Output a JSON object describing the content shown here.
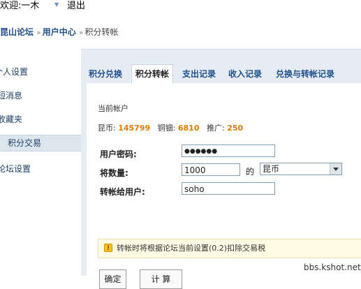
{
  "topbar": {
    "welcome": "欢迎:一木",
    "logout": "退出"
  },
  "breadcrumb": {
    "forum": "昆山论坛",
    "usercenter": "用户中心",
    "current": "积分转帐",
    "separator": "»"
  },
  "sidebar": {
    "items": [
      {
        "label": "个人设置"
      },
      {
        "label": "短消息"
      },
      {
        "label": "收藏夹"
      },
      {
        "label": "积分交易",
        "active": true
      },
      {
        "label": "论坛设置"
      }
    ]
  },
  "tabs": [
    {
      "label": "积分兑换"
    },
    {
      "label": "积分转帐",
      "active": true
    },
    {
      "label": "支出记录"
    },
    {
      "label": "收入记录"
    },
    {
      "label": "兑换与转帐记录"
    }
  ],
  "account": {
    "title": "当前帐户",
    "balances": [
      {
        "label": "昆币:",
        "value": "145799"
      },
      {
        "label": "铜钿:",
        "value": "6810"
      },
      {
        "label": "推广:",
        "value": "250"
      }
    ]
  },
  "form": {
    "password_label": "用户密码:",
    "password_value": "●●●●●●",
    "amount_label": "将数量:",
    "amount_value": "1000",
    "of_text": "的",
    "currency_value": "昆币",
    "recipient_label": "转帐给用户:",
    "recipient_value": "soho"
  },
  "notice": {
    "text": "转帐时将根据论坛当前设置(0.2)扣除交易税"
  },
  "buttons": {
    "confirm": "确定",
    "calc": "计 算"
  },
  "watermark": "bbs.kshot.net",
  "colors": {
    "link": "#1d4f8c",
    "highlight": "#e07a00",
    "panel": "#e6ecf4"
  }
}
